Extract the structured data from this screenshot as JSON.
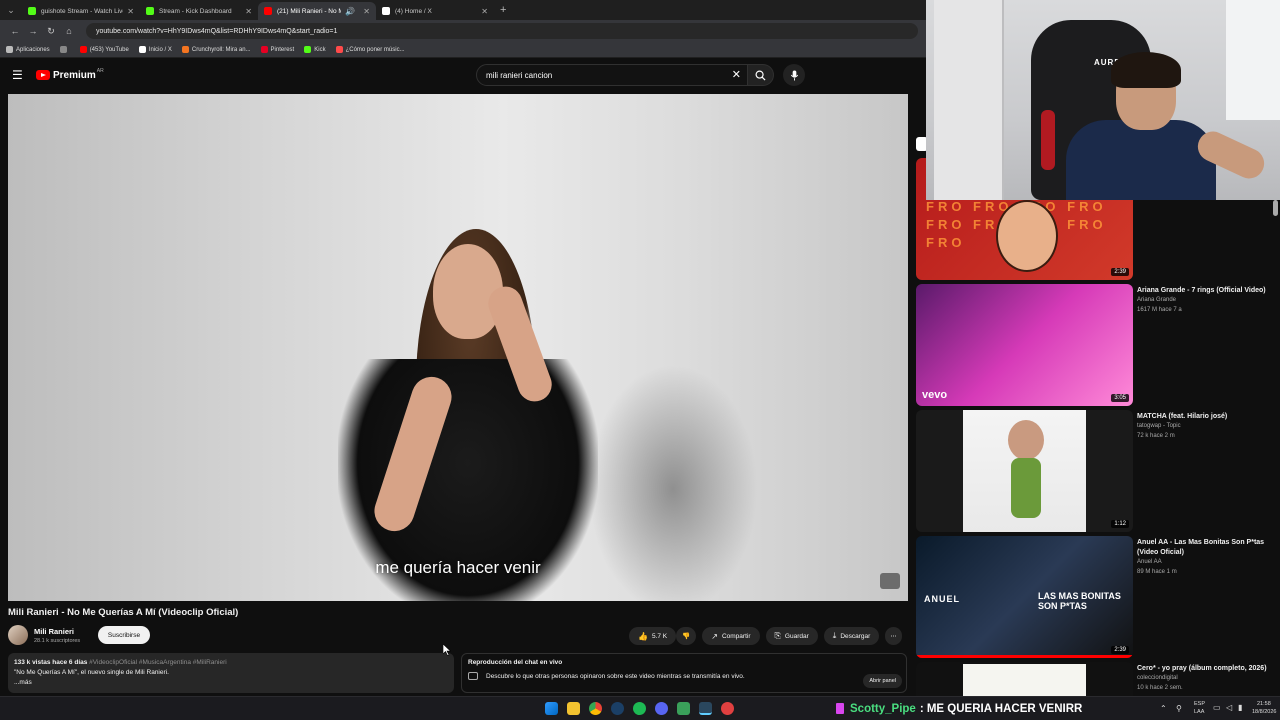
{
  "browser": {
    "tabs": [
      {
        "title": "guishote Stream - Watch Live o...",
        "favicon_color": "#53fc18",
        "active": false
      },
      {
        "title": "Stream - Kick Dashboard",
        "favicon_color": "#53fc18",
        "active": false
      },
      {
        "title": "(21) Mili Ranieri - No Me Q...",
        "favicon_color": "#ff0000",
        "active": true
      },
      {
        "title": "(4) Home / X",
        "favicon_color": "#ffffff",
        "active": false
      }
    ],
    "url": "youtube.com/watch?v=HhY9IDws4mQ&list=RDHhY9IDws4mQ&start_radio=1",
    "bookmarks": [
      {
        "label": "Aplicaciones",
        "color": "#bbbbbb"
      },
      {
        "label": "(453) YouTube",
        "color": "#ff0000"
      },
      {
        "label": "Inicio / X",
        "color": "#ffffff"
      },
      {
        "label": "Crunchyroll: Mira an...",
        "color": "#f47521"
      },
      {
        "label": "Pinterest",
        "color": "#e60023"
      },
      {
        "label": "Kick",
        "color": "#53fc18"
      },
      {
        "label": "¿Cómo poner músic...",
        "color": "#ff4a4a"
      }
    ]
  },
  "youtube": {
    "logo_text": "Premium",
    "region": "AR",
    "search_value": "mili ranieri cancion",
    "video": {
      "caption": "me quería hacer venir",
      "title": "Mili Ranieri - No Me Querías A Mí (Videoclip Oficial)",
      "channel": "Mili Ranieri",
      "subscribers": "28.1 k suscriptores",
      "subscribe_label": "Suscribirse",
      "likes": "5.7 K",
      "share_label": "Compartir",
      "save_label": "Guardar",
      "download_label": "Descargar",
      "desc_stats": "133 k vistas  hace 6 días",
      "desc_tags": "#VideoclipOficial #MusicaArgentina #MiliRanieri",
      "desc_line": "\"No Me Querías A Mí\", el nuevo single de Mili Ranieri.",
      "desc_more": "...más"
    },
    "chat_replay": {
      "title": "Reproducción del chat en vivo",
      "text": "Descubre lo que otras personas opinaron sobre este video mientras se transmitía en vivo.",
      "button": "Abrir panel"
    },
    "recommendations": [
      {
        "title": "",
        "channel": "",
        "meta": "",
        "duration": "2:39"
      },
      {
        "title": "Ariana Grande - 7 rings (Official Video)",
        "channel": "Ariana Grande",
        "meta": "1617 M  hace 7 a",
        "duration": "3:05"
      },
      {
        "title": "MATCHA (feat. Hilario josé)",
        "channel": "tatogwap - Topic",
        "meta": "72 k  hace 2 m",
        "duration": "1:12"
      },
      {
        "title": "Anuel AA - Las Mas Bonitas Son P*tas (Video Oficial)",
        "channel": "Anuel AA",
        "meta": "89 M  hace 1 m",
        "duration": "2:39"
      },
      {
        "title": "Cero* - yo pray (álbum completo, 2026)",
        "channel": "colecciondigital",
        "meta": "10 k  hace 2 sem.",
        "duration": ""
      }
    ]
  },
  "webcam": {
    "chair_brand": "AUREOX"
  },
  "stream_overlay": {
    "username": "Scotty_Pipe",
    "message": ": ME QUERIA HACER VENIRR"
  },
  "taskbar": {
    "lang": "ESP",
    "lang2": "LAA",
    "time": "21:58",
    "date": "18/8/2026"
  }
}
